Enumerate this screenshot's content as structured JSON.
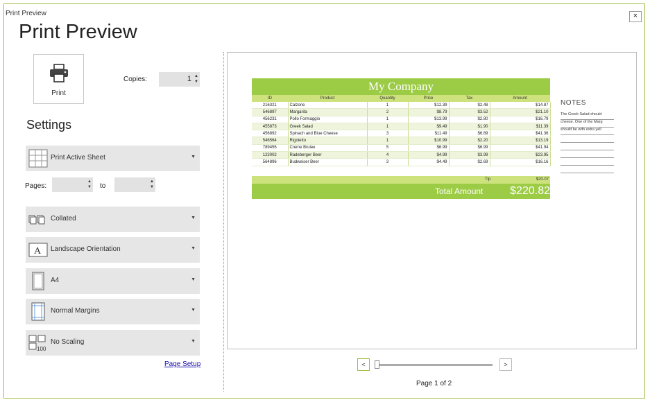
{
  "window": {
    "title": "Print Preview",
    "close_label": "×"
  },
  "heading": "Print Preview",
  "print_button": {
    "label": "Print"
  },
  "copies": {
    "label": "Copies:",
    "value": "1"
  },
  "settings": {
    "title": "Settings",
    "print_what": "Print Active Sheet",
    "pages_label": "Pages:",
    "pages_to": "to",
    "collation": "Collated",
    "orientation": "Landscape Orientation",
    "paper_size": "A4",
    "margins": "Normal Margins",
    "scaling": "No Scaling",
    "page_setup_link": "Page Setup"
  },
  "preview": {
    "company": "My Company",
    "columns": [
      "ID",
      "Product",
      "Quantity",
      "Price",
      "Tax",
      "Amount"
    ],
    "rows": [
      [
        "216321",
        "Calzone",
        "1",
        "$12.39",
        "$2.48",
        "$14.87"
      ],
      [
        "546897",
        "Margarita",
        "2",
        "$8.79",
        "$3.52",
        "$21.10"
      ],
      [
        "456231",
        "Pollo Formaggio",
        "1",
        "$13.99",
        "$2.80",
        "$16.79"
      ],
      [
        "455873",
        "Greek Salad",
        "1",
        "$9.49",
        "$1.90",
        "$11.39"
      ],
      [
        "456892",
        "Spinach and Blue Cheese",
        "3",
        "$11.49",
        "$6.89",
        "$41.36"
      ],
      [
        "546564",
        "Rigoletto",
        "1",
        "$10.99",
        "$2.20",
        "$13.19"
      ],
      [
        "789455",
        "Creme Brulee",
        "5",
        "$6.99",
        "$6.99",
        "$41.94"
      ],
      [
        "123002",
        "Radeberger Beer",
        "4",
        "$4.99",
        "$3.99",
        "$23.95"
      ],
      [
        "564896",
        "Budweiser Beer",
        "3",
        "$4.49",
        "$2.69",
        "$16.16"
      ]
    ],
    "tip_label": "Tip",
    "tip_value": "$20.07",
    "total_label": "Total Amount",
    "total_value": "$220.82",
    "notes_title": "NOTES",
    "notes_lines": [
      "The Greek Salad should",
      "cheese. One of the Marg",
      "should be with extra yell",
      "",
      "",
      "",
      "",
      ""
    ]
  },
  "navigation": {
    "prev": "<",
    "next": ">",
    "page_status": "Page 1 of 2",
    "zoom_fraction": 0.02
  },
  "colors": {
    "accent": "#9dbd3c",
    "table_header": "#cde27d",
    "table_title": "#9ccb45"
  }
}
